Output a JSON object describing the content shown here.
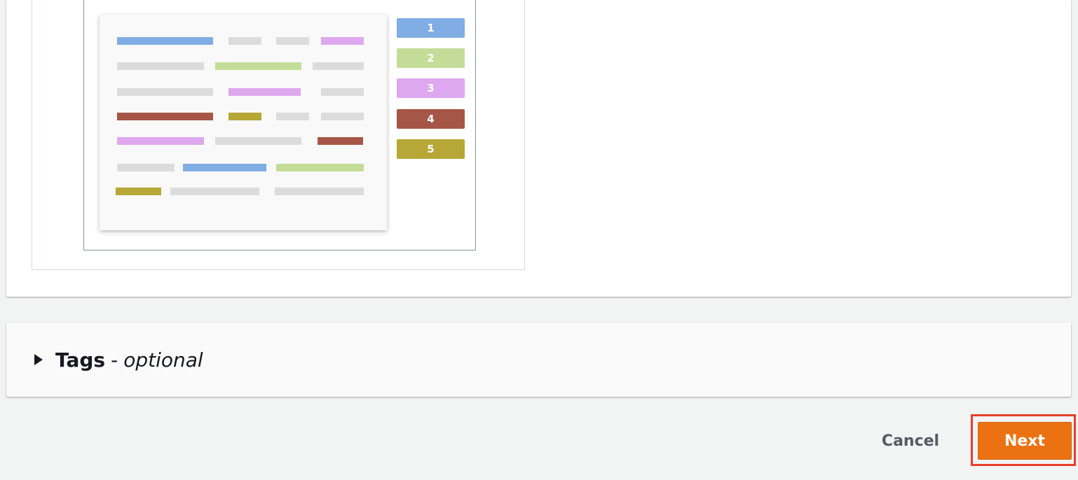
{
  "illustration": {
    "legend": [
      {
        "label": "1",
        "color": "#80ade3"
      },
      {
        "label": "2",
        "color": "#c3dd99"
      },
      {
        "label": "3",
        "color": "#dea8ee"
      },
      {
        "label": "4",
        "color": "#a65646"
      },
      {
        "label": "5",
        "color": "#b6a737"
      }
    ],
    "placeholder_color": "#dcdcdc"
  },
  "tags_section": {
    "title": "Tags",
    "separator": "-",
    "optional_label": "optional"
  },
  "footer": {
    "cancel_label": "Cancel",
    "next_label": "Next",
    "accent_color": "#ec7211",
    "highlight_color": "#e6402c"
  }
}
